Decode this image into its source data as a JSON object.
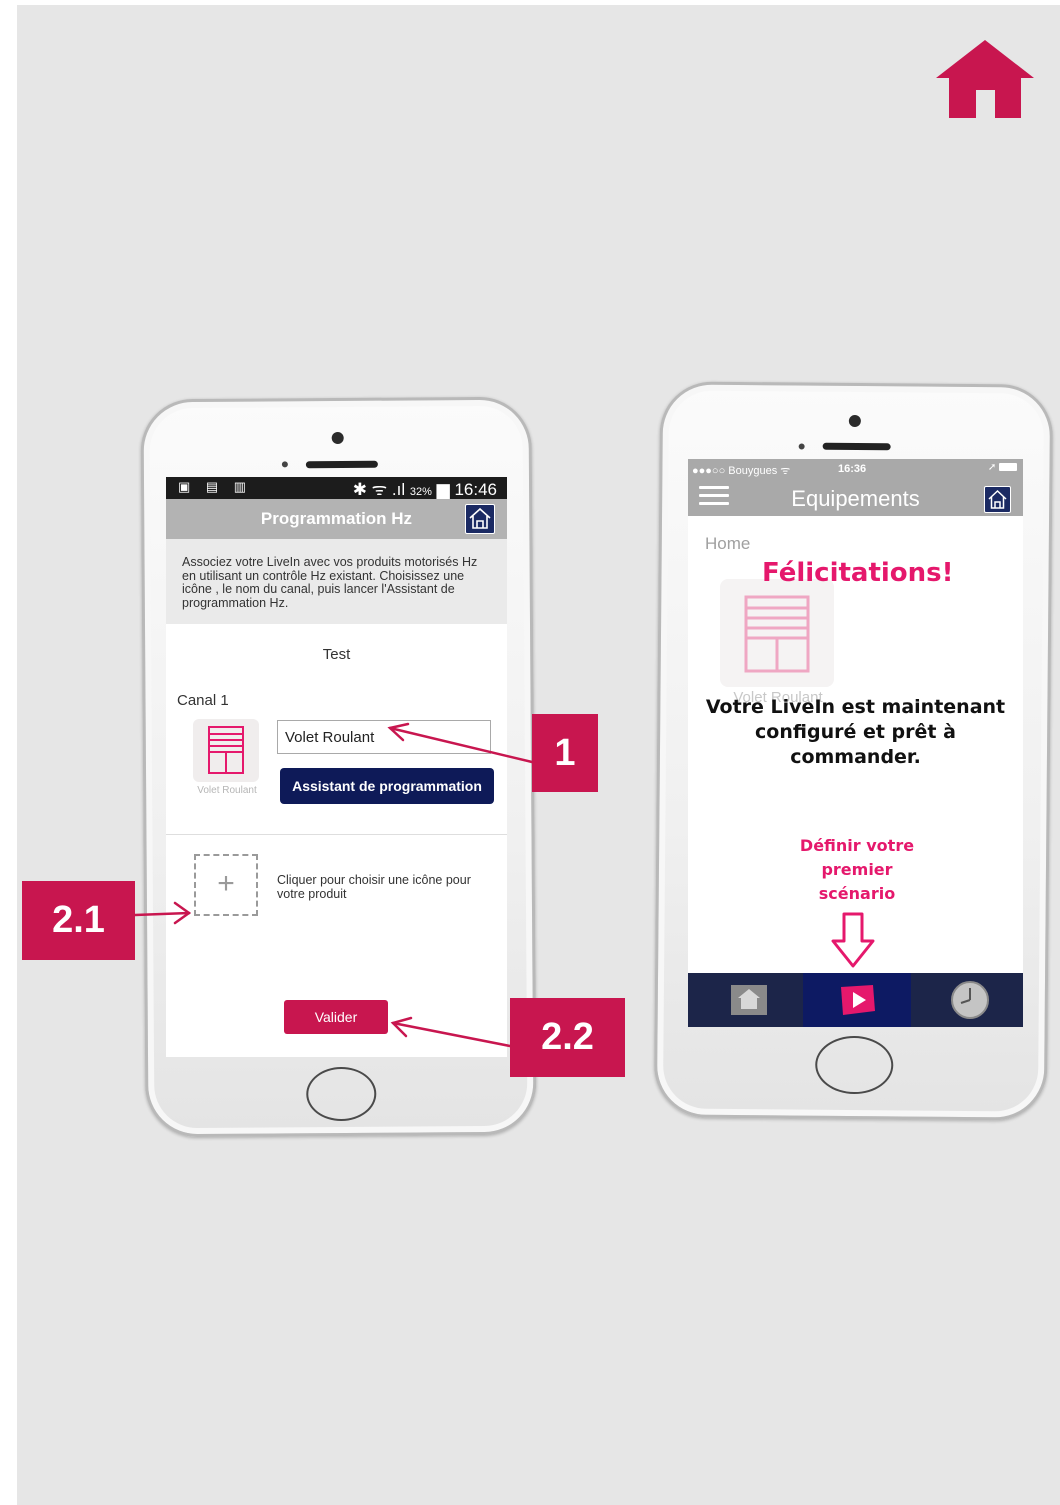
{
  "colors": {
    "accent": "#c8164f",
    "pink_text": "#e5186c",
    "navy": "#0e1a58",
    "background": "#e6e6e6"
  },
  "left_screen": {
    "status_bar": {
      "icons_left": "▣ ▤ ▥",
      "signal": "✱ ᯤ .ıl",
      "battery": "32%",
      "time": "16:46"
    },
    "app_bar": {
      "title": "Programmation Hz",
      "home_icon": "house-outline-icon"
    },
    "intro_text": "Associez votre LiveIn avec vos produits motorisés Hz en utilisant un contrôle Hz existant. Choisissez une icône , le nom du canal, puis lancer l'Assistant de programmation Hz.",
    "product_name": "Test",
    "channel": {
      "label": "Canal 1",
      "icon": "roller-shutter-icon",
      "icon_caption": "Volet Roulant",
      "name_value": "Volet Roulant",
      "assistant_button": "Assistant de programmation"
    },
    "add_icon": {
      "icon": "plus-icon",
      "hint": "Cliquer pour choisir une icône pour votre produit"
    },
    "validate_button": "Valider"
  },
  "right_screen": {
    "status_bar": {
      "carrier": "●●●○○ Bouygues ᯤ",
      "time": "16:36",
      "right": "➚"
    },
    "nav": {
      "title": "Equipements",
      "menu_icon": "hamburger-icon",
      "home_icon": "house-outline-icon"
    },
    "breadcrumb": "Home",
    "equipment_tile_caption": "Volet Roulant",
    "congrats_title": "Félicitations!",
    "congrats_message": "Votre LiveIn est maintenant configuré et prêt à commander.",
    "cta_text": "Définir votre premier scénario",
    "tabs": [
      {
        "name": "home",
        "icon": "home-tab-icon"
      },
      {
        "name": "scenarios",
        "icon": "play-icon",
        "active": true
      },
      {
        "name": "schedule",
        "icon": "clock-icon"
      }
    ]
  },
  "callouts": {
    "one": "1",
    "two_one": "2.1",
    "two_two": "2.2"
  }
}
